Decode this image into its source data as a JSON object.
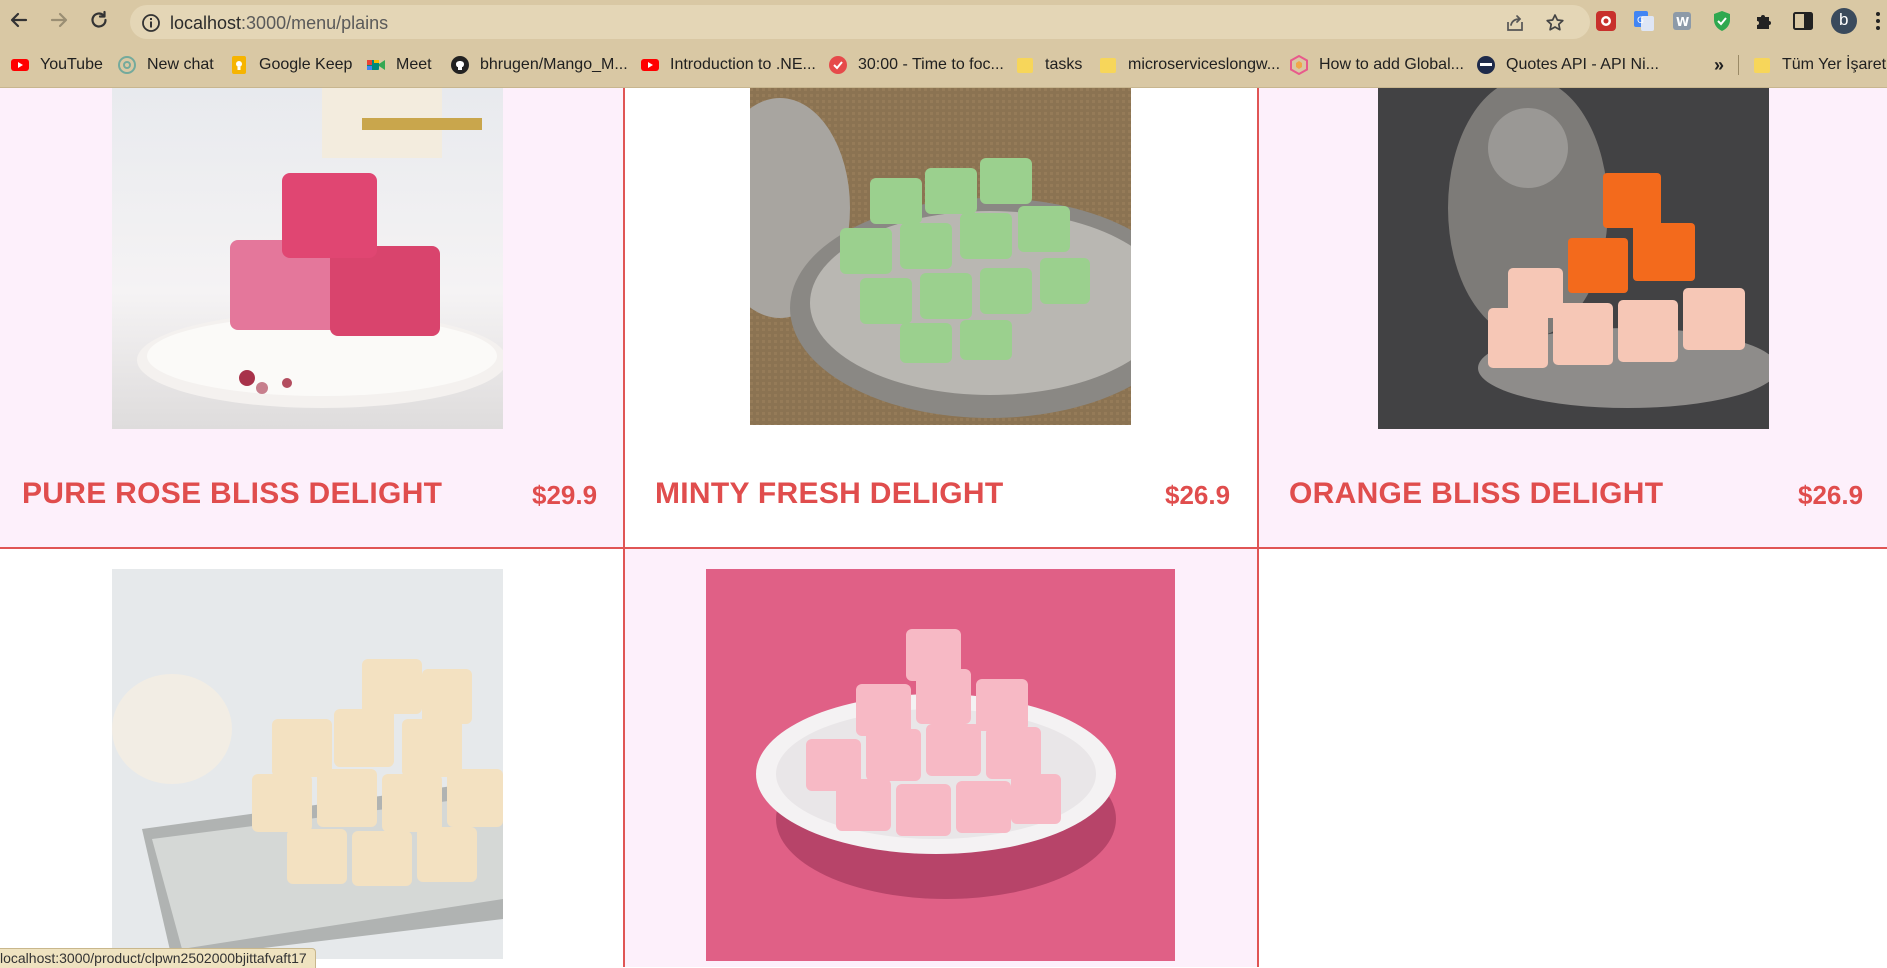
{
  "browser": {
    "url_host": "localhost",
    "url_rest": ":3000/menu/plains",
    "profile_initial": "b",
    "bookmarks": [
      {
        "label": "YouTube",
        "icon": "youtube-icon",
        "color": "#ff0000"
      },
      {
        "label": "New chat",
        "icon": "openai-icon",
        "color": "#74aa9c"
      },
      {
        "label": "Google Keep",
        "icon": "google-keep-icon",
        "color": "#f6b400"
      },
      {
        "label": "Meet",
        "icon": "google-meet-icon",
        "color": "#00897b"
      },
      {
        "label": "bhrugen/Mango_M...",
        "icon": "github-icon",
        "color": "#222222"
      },
      {
        "label": "Introduction to .NE...",
        "icon": "youtube-icon",
        "color": "#ff0000"
      },
      {
        "label": "30:00 - Time to foc...",
        "icon": "check-circle-icon",
        "color": "#e64a4a"
      },
      {
        "label": "tasks",
        "icon": "folder-icon",
        "color": "#f7d65a"
      },
      {
        "label": "microserviceslongw...",
        "icon": "folder-icon",
        "color": "#f7d65a"
      },
      {
        "label": "How to add Global...",
        "icon": "hexagon-icon",
        "color": "#e85a8c"
      },
      {
        "label": "Quotes API - API Ni...",
        "icon": "ninja-icon",
        "color": "#1e2a4a"
      }
    ],
    "overflow_label": "»",
    "other_bookmarks_label": "Tüm Yer İşaretleri",
    "status_text": "localhost:3000/product/clpwn2502000bjittafvaft17"
  },
  "products": [
    {
      "name": "PURE ROSE BLISS DELIGHT",
      "price": "$29.9",
      "color": "#e0406f"
    },
    {
      "name": "MINTY FRESH DELIGHT",
      "price": "$26.9",
      "color": "#8fd68a"
    },
    {
      "name": "ORANGE BLISS DELIGHT",
      "price": "$26.9",
      "color": "#f26b1d"
    },
    {
      "name": "",
      "price": "",
      "color": "#f4e6c8"
    },
    {
      "name": "",
      "price": "",
      "color": "#f5b5c4"
    }
  ],
  "theme": {
    "accent": "#e04d4d",
    "card_bg": "#fdf0fb",
    "chrome_bg": "#d9c8a4"
  }
}
